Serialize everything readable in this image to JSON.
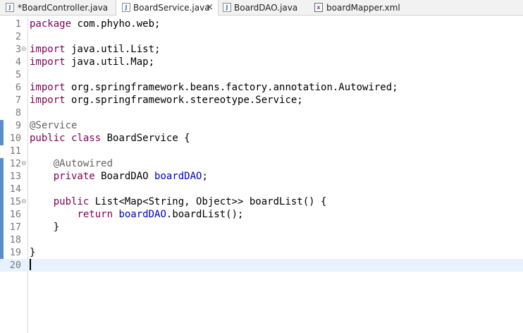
{
  "tabs": [
    {
      "label": "*BoardController.java",
      "icon": "java-file-icon",
      "active": false
    },
    {
      "label": "BoardService.java",
      "icon": "java-file-icon",
      "active": true,
      "close": "×"
    },
    {
      "label": "BoardDAO.java",
      "icon": "java-file-icon",
      "active": false
    },
    {
      "label": "boardMapper.xml",
      "icon": "xml-file-icon",
      "active": false
    }
  ],
  "icon_glyphs": {
    "java": "J",
    "xml": "x"
  },
  "fold_glyph": "⊖",
  "lines": [
    {
      "n": "1",
      "t": [
        {
          "c": "kw",
          "s": "package"
        },
        {
          "s": " com.phyho.web;"
        }
      ]
    },
    {
      "n": "2",
      "t": []
    },
    {
      "n": "3",
      "fold": true,
      "t": [
        {
          "c": "kw",
          "s": "import"
        },
        {
          "s": " java.util.List;"
        }
      ]
    },
    {
      "n": "4",
      "t": [
        {
          "c": "kw",
          "s": "import"
        },
        {
          "s": " java.util.Map;"
        }
      ]
    },
    {
      "n": "5",
      "t": []
    },
    {
      "n": "6",
      "t": [
        {
          "c": "kw",
          "s": "import"
        },
        {
          "s": " org.springframework.beans.factory.annotation.Autowired;"
        }
      ]
    },
    {
      "n": "7",
      "t": [
        {
          "c": "kw",
          "s": "import"
        },
        {
          "s": " org.springframework.stereotype.Service;"
        }
      ]
    },
    {
      "n": "8",
      "t": []
    },
    {
      "n": "9",
      "t": [
        {
          "c": "ann",
          "s": "@Service"
        }
      ]
    },
    {
      "n": "10",
      "t": [
        {
          "c": "kw",
          "s": "public"
        },
        {
          "s": " "
        },
        {
          "c": "kw",
          "s": "class"
        },
        {
          "s": " BoardService {"
        }
      ]
    },
    {
      "n": "11",
      "t": []
    },
    {
      "n": "12",
      "fold": true,
      "t": [
        {
          "s": "    "
        },
        {
          "c": "ann",
          "s": "@Autowired"
        }
      ]
    },
    {
      "n": "13",
      "t": [
        {
          "s": "    "
        },
        {
          "c": "kw",
          "s": "private"
        },
        {
          "s": " BoardDAO "
        },
        {
          "c": "fld",
          "s": "boardDAO"
        },
        {
          "s": ";"
        }
      ]
    },
    {
      "n": "14",
      "t": []
    },
    {
      "n": "15",
      "fold": true,
      "t": [
        {
          "s": "    "
        },
        {
          "c": "kw",
          "s": "public"
        },
        {
          "s": " List<Map<String, Object>> boardList() {"
        }
      ]
    },
    {
      "n": "16",
      "t": [
        {
          "s": "        "
        },
        {
          "c": "kw",
          "s": "return"
        },
        {
          "s": " "
        },
        {
          "c": "fld",
          "s": "boardDAO"
        },
        {
          "s": ".boardList();"
        }
      ]
    },
    {
      "n": "17",
      "t": [
        {
          "s": "    }"
        }
      ]
    },
    {
      "n": "18",
      "t": []
    },
    {
      "n": "19",
      "t": [
        {
          "s": "}"
        }
      ]
    },
    {
      "n": "20",
      "current": true,
      "t": []
    }
  ],
  "colors": {
    "keyword": "#7f0055",
    "annotation": "#646464",
    "field": "#0000c0",
    "line_number": "#787878",
    "current_line": "#e8f2fe",
    "change_marker": "#5b8fc9"
  }
}
